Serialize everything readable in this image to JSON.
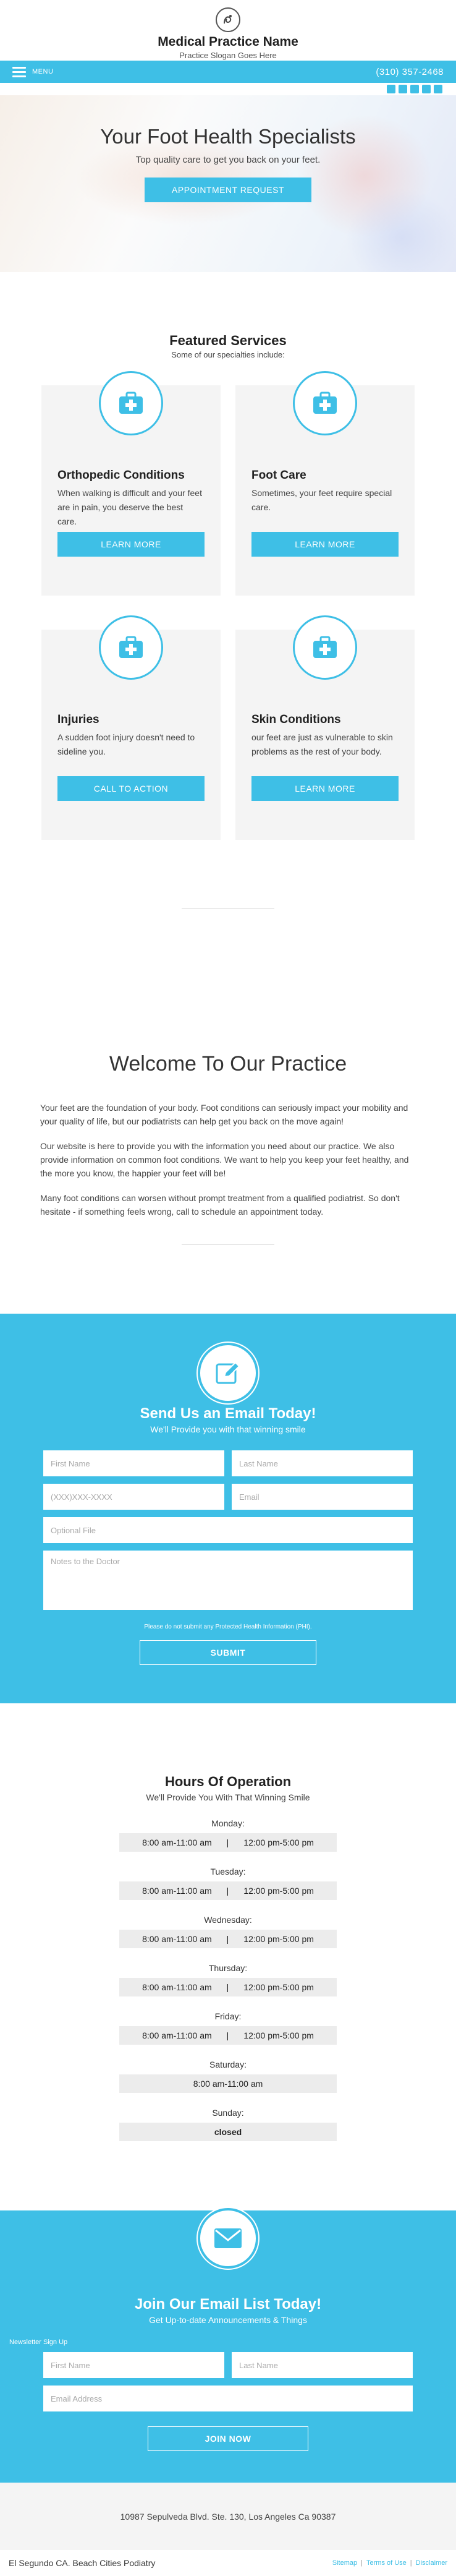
{
  "header": {
    "title": "Medical Practice Name",
    "slogan": "Practice Slogan Goes Here",
    "menu_label": "MENU",
    "phone": "(310) 357-2468"
  },
  "hero": {
    "title": "Your Foot Health Specialists",
    "subtitle": "Top quality care to get you back on your feet.",
    "button": "APPOINTMENT REQUEST"
  },
  "services": {
    "title": "Featured Services",
    "subtitle": "Some of our specialties include:",
    "items": [
      {
        "title": "Orthopedic Conditions",
        "text": "When walking is difficult and your feet are in pain, you deserve the best care.",
        "button": "LEARN MORE"
      },
      {
        "title": "Foot Care",
        "text": "Sometimes, your feet require special care.",
        "button": "LEARN MORE"
      },
      {
        "title": "Injuries",
        "text": "A sudden foot injury doesn't need to sideline you.",
        "button": "CALL TO ACTION"
      },
      {
        "title": "Skin Conditions",
        "text": "our feet are just as vulnerable to skin problems as the rest of your body.",
        "button": "LEARN MORE"
      }
    ]
  },
  "welcome": {
    "title": "Welcome To Our Practice",
    "paragraphs": [
      "Your feet are the foundation of your body. Foot conditions can seriously impact your mobility and your quality of life, but our podiatrists can help get you back on the move again!",
      "Our website is here to provide you with the information you need about our practice. We also provide information on common foot conditions. We want to help you keep your feet healthy, and the more you know, the happier your feet will be!",
      "Many foot conditions can worsen without prompt treatment from a qualified podiatrist. So don't hesitate - if something feels wrong, call to schedule an appointment today."
    ]
  },
  "email_form": {
    "title": "Send Us an Email Today!",
    "subtitle": "We'll Provide you with that winning smile",
    "first_name": "First Name",
    "last_name": "Last Name",
    "phone": "(XXX)XXX-XXXX",
    "email": "Email",
    "optional_file": "Optional File",
    "notes": "Notes to the Doctor",
    "notice": "Please do not submit any Protected Health Information (PHI).",
    "submit": "SUBMIT"
  },
  "hours": {
    "title": "Hours Of Operation",
    "subtitle": "We'll Provide You With That Winning Smile",
    "days": [
      {
        "day": "Monday:",
        "open": "8:00 am-11:00 am",
        "close": "12:00 pm-5:00 pm"
      },
      {
        "day": "Tuesday:",
        "open": "8:00 am-11:00 am",
        "close": "12:00 pm-5:00 pm"
      },
      {
        "day": "Wednesday:",
        "open": "8:00 am-11:00 am",
        "close": "12:00 pm-5:00 pm"
      },
      {
        "day": "Thursday:",
        "open": "8:00 am-11:00 am",
        "close": "12:00 pm-5:00 pm"
      },
      {
        "day": "Friday:",
        "open": "8:00 am-11:00 am",
        "close": "12:00 pm-5:00 pm"
      },
      {
        "day": "Saturday:",
        "single": "8:00 am-11:00 am"
      },
      {
        "day": "Sunday:",
        "single": "closed"
      }
    ]
  },
  "newsletter": {
    "title": "Join Our Email List Today!",
    "subtitle": "Get Up-to-date Announcements & Things",
    "label": "Newsletter Sign Up",
    "first_name": "First Name",
    "last_name": "Last Name",
    "email": "Email Address",
    "button": "JOIN NOW"
  },
  "footer": {
    "address": "10987 Sepulveda Blvd. Ste. 130, Los Angeles Ca 90387",
    "cities": "El Segundo CA. Beach Cities Podiatry",
    "links": [
      "Sitemap",
      "Terms of Use",
      "Disclaimer"
    ]
  },
  "colors": {
    "accent": "#3ebfe6",
    "card_bg": "#f4f4f4",
    "text": "#333333"
  },
  "icons": {
    "services": [
      "first-aid-kit-icon",
      "first-aid-kit-icon",
      "first-aid-kit-icon",
      "first-aid-kit-icon"
    ],
    "email_section": "pencil-square-icon",
    "newsletter_section": "envelope-icon"
  }
}
